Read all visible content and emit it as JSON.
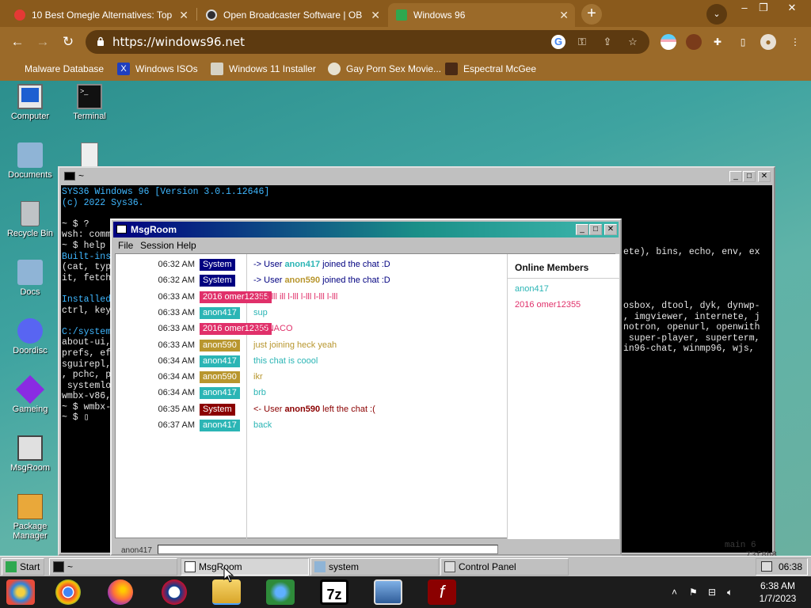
{
  "browser": {
    "tabs": [
      {
        "title": "10 Best Omegle Alternatives: Top",
        "active": false
      },
      {
        "title": "Open Broadcaster Software | OB",
        "active": false
      },
      {
        "title": "Windows 96",
        "active": true
      }
    ],
    "url": "https://windows96.net",
    "bookmarks": [
      "Malware Database",
      "Windows ISOs",
      "Windows 11 Installer",
      "Gay Porn Sex Movie...",
      "Espectral McGee"
    ]
  },
  "desktop": {
    "icons": [
      "Computer",
      "Terminal",
      "Documents",
      "Recycle Bin",
      "Docs",
      "Doordisc",
      "Gameing",
      "MsgRoom",
      "Package Manager"
    ]
  },
  "terminal": {
    "title": "~",
    "lines": [
      {
        "text": "SYS36 Windows 96 [Version 3.0.1.12646]",
        "cyan": true
      },
      {
        "text": "(c) 2022 Sys36.",
        "cyan": true
      },
      {
        "text": "",
        "cyan": false
      },
      {
        "text": "~ $ ?",
        "cyan": false
      },
      {
        "text": "wsh: comm",
        "cyan": false
      },
      {
        "text": "~ $ help",
        "cyan": false
      },
      {
        "text": "Built-ins",
        "cyan": true
      },
      {
        "text": "(cat, typ",
        "cyan": false
      },
      {
        "text": "it, fetch",
        "cyan": false
      },
      {
        "text": "",
        "cyan": false
      },
      {
        "text": "Installed",
        "cyan": true
      },
      {
        "text": "ctrl, key",
        "cyan": false
      },
      {
        "text": "",
        "cyan": false
      },
      {
        "text": "C:/system",
        "cyan": true
      },
      {
        "text": "about-ui,",
        "cyan": false
      },
      {
        "text": "prefs, ef",
        "cyan": false
      },
      {
        "text": "sguirepl,",
        "cyan": false
      },
      {
        "text": ", pchc, p",
        "cyan": false
      },
      {
        "text": " systemlo",
        "cyan": false
      },
      {
        "text": "wmbx-v86,",
        "cyan": false
      },
      {
        "text": "~ $ wmbx-",
        "cyan": false
      },
      {
        "text": "~ $ ▯",
        "cyan": false
      }
    ],
    "right_lines": [
      "ete), bins, echo, env, ex",
      "",
      "",
      "",
      "",
      "osbox, dtool, dyk, dynwp-",
      ", imgviewer, internete, j",
      "notron, openurl, openwith",
      " super-player, superterm,",
      "in96-chat, winmp96, wjs,"
    ],
    "faint_right": [
      "6 main",
      "73f8b8"
    ]
  },
  "msgroom": {
    "title": "MsgRoom",
    "menu": [
      "File",
      "Session",
      "Help"
    ],
    "messages": [
      {
        "time": "06:32 AM",
        "badge": "System",
        "badge_color": "#000080",
        "text_pre": "-> User ",
        "user": "anon417",
        "user_color": "#2bb5b5",
        "text_post": " joined the chat :D",
        "text_color": "#000080"
      },
      {
        "time": "06:32 AM",
        "badge": "System",
        "badge_color": "#000080",
        "text_pre": "-> User ",
        "user": "anon590",
        "user_color": "#b8962e",
        "text_post": " joined the chat :D",
        "text_color": "#000080"
      },
      {
        "time": "06:33 AM",
        "badge": "2016 omer12355",
        "badge_color": "#e0306a",
        "text_pre": "",
        "user": "",
        "user_color": "",
        "text_post": "l-lll l-lll ill l-lll l-lll l-lll l-lll",
        "text_color": "#e0306a"
      },
      {
        "time": "06:33 AM",
        "badge": "anon417",
        "badge_color": "#2bb5b5",
        "text_pre": "",
        "user": "",
        "user_color": "",
        "text_post": "sup",
        "text_color": "#2bb5b5"
      },
      {
        "time": "06:33 AM",
        "badge": "2016 omer12355",
        "badge_color": "#e0306a",
        "text_pre": "",
        "user": "",
        "user_color": "",
        "text_post": "MONACO",
        "text_color": "#e0306a"
      },
      {
        "time": "06:33 AM",
        "badge": "anon590",
        "badge_color": "#b8962e",
        "text_pre": "",
        "user": "",
        "user_color": "",
        "text_post": "just joining heck yeah",
        "text_color": "#b8962e"
      },
      {
        "time": "06:34 AM",
        "badge": "anon417",
        "badge_color": "#2bb5b5",
        "text_pre": "",
        "user": "",
        "user_color": "",
        "text_post": "this chat is coool",
        "text_color": "#2bb5b5"
      },
      {
        "time": "06:34 AM",
        "badge": "anon590",
        "badge_color": "#b8962e",
        "text_pre": "",
        "user": "",
        "user_color": "",
        "text_post": "ikr",
        "text_color": "#b8962e"
      },
      {
        "time": "06:34 AM",
        "badge": "anon417",
        "badge_color": "#2bb5b5",
        "text_pre": "",
        "user": "",
        "user_color": "",
        "text_post": "brb",
        "text_color": "#2bb5b5"
      },
      {
        "time": "06:35 AM",
        "badge": "System",
        "badge_color": "#8b0000",
        "text_pre": "<- User ",
        "user": "anon590",
        "user_color": "#8b0000",
        "text_post": " left the chat :(",
        "text_color": "#8b0000"
      },
      {
        "time": "06:37 AM",
        "badge": "anon417",
        "badge_color": "#2bb5b5",
        "text_pre": "",
        "user": "",
        "user_color": "",
        "text_post": "back",
        "text_color": "#2bb5b5"
      }
    ],
    "members_title": "Online Members",
    "members": [
      {
        "name": "anon417",
        "color": "#2bb5b5"
      },
      {
        "name": "2016 omer12355",
        "color": "#e0306a"
      }
    ],
    "nick": "anon417"
  },
  "w96_taskbar": {
    "start": "Start",
    "buttons": [
      {
        "label": "~",
        "pressed": false
      },
      {
        "label": "MsgRoom",
        "pressed": true
      },
      {
        "label": "system",
        "pressed": false
      },
      {
        "label": "Control Panel",
        "pressed": false
      }
    ],
    "time": "06:38"
  },
  "win_taskbar": {
    "time": "6:38 AM",
    "date": "1/7/2023"
  }
}
